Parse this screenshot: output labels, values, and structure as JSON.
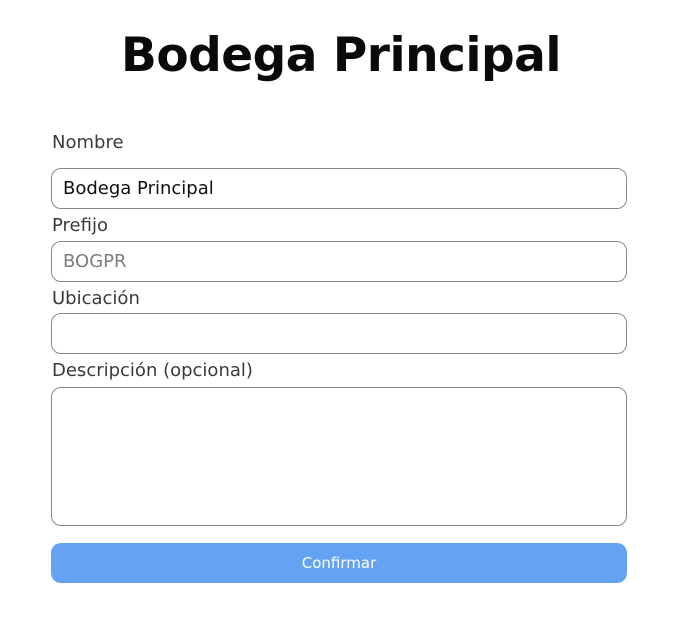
{
  "header": {
    "title": "Bodega Principal"
  },
  "form": {
    "nombre": {
      "label": "Nombre",
      "value": "Bodega Principal",
      "placeholder": ""
    },
    "prefijo": {
      "label": "Prefijo",
      "value": "",
      "placeholder": "BOGPR"
    },
    "ubicacion": {
      "label": "Ubicación",
      "value": "",
      "placeholder": ""
    },
    "descripcion": {
      "label": "Descripción (opcional)",
      "value": "",
      "placeholder": ""
    },
    "confirm_label": "Confirmar"
  },
  "colors": {
    "button_background": "#64a3f3",
    "button_text": "#ffffff",
    "input_border": "#8a8a8a"
  }
}
